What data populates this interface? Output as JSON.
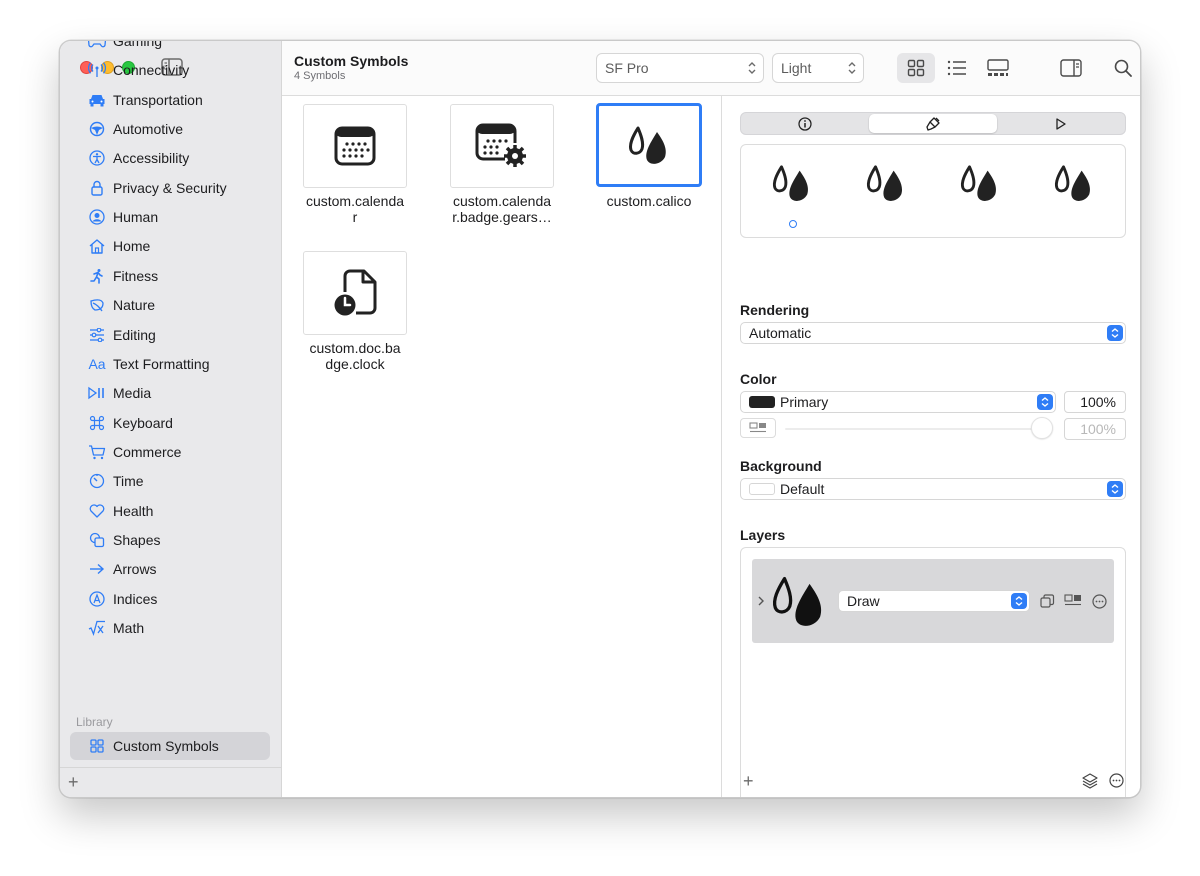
{
  "window": {
    "title": "Custom Symbols",
    "subtitle": "4 Symbols"
  },
  "sidebar": {
    "items": [
      {
        "label": "Gaming",
        "icon": "gamecontroller-icon"
      },
      {
        "label": "Connectivity",
        "icon": "antenna-icon"
      },
      {
        "label": "Transportation",
        "icon": "car-icon"
      },
      {
        "label": "Automotive",
        "icon": "steering-wheel-icon"
      },
      {
        "label": "Accessibility",
        "icon": "accessibility-icon"
      },
      {
        "label": "Privacy & Security",
        "icon": "lock-icon"
      },
      {
        "label": "Human",
        "icon": "person-icon"
      },
      {
        "label": "Home",
        "icon": "house-icon"
      },
      {
        "label": "Fitness",
        "icon": "figure-run-icon"
      },
      {
        "label": "Nature",
        "icon": "leaf-icon"
      },
      {
        "label": "Editing",
        "icon": "sliders-icon"
      },
      {
        "label": "Text Formatting",
        "icon": "textformat-icon"
      },
      {
        "label": "Media",
        "icon": "playpause-icon"
      },
      {
        "label": "Keyboard",
        "icon": "command-icon"
      },
      {
        "label": "Commerce",
        "icon": "cart-icon"
      },
      {
        "label": "Time",
        "icon": "timer-icon"
      },
      {
        "label": "Health",
        "icon": "heart-icon"
      },
      {
        "label": "Shapes",
        "icon": "shapes-icon"
      },
      {
        "label": "Arrows",
        "icon": "arrow-right-icon"
      },
      {
        "label": "Indices",
        "icon": "a-circle-icon"
      },
      {
        "label": "Math",
        "icon": "sqrt-icon"
      }
    ],
    "library_label": "Library",
    "library_items": [
      {
        "label": "Custom Symbols",
        "icon": "grid-icon"
      }
    ]
  },
  "toolbar": {
    "font_popup": "SF Pro",
    "weight_popup": "Light"
  },
  "symbols": [
    {
      "name": "custom.calenda\nr",
      "icon": "calendar-icon"
    },
    {
      "name": "custom.calenda\nr.badge.gears…",
      "icon": "calendar-gear-icon"
    },
    {
      "name": "custom.calico",
      "icon": "drops-icon",
      "selected": true
    },
    {
      "name": "custom.doc.ba\ndge.clock",
      "icon": "doc-clock-icon"
    }
  ],
  "inspector": {
    "rendering_label": "Rendering",
    "rendering_value": "Automatic",
    "color_label": "Color",
    "color_value": "Primary",
    "color_swatch": "#222222",
    "color_opacity": "100%",
    "secondary_opacity": "100%",
    "background_label": "Background",
    "background_value": "Default",
    "layers_label": "Layers",
    "layer_mode": "Draw"
  },
  "colors": {
    "accent": "#2f7df6",
    "sidebar_bg": "#e9e9eb"
  }
}
